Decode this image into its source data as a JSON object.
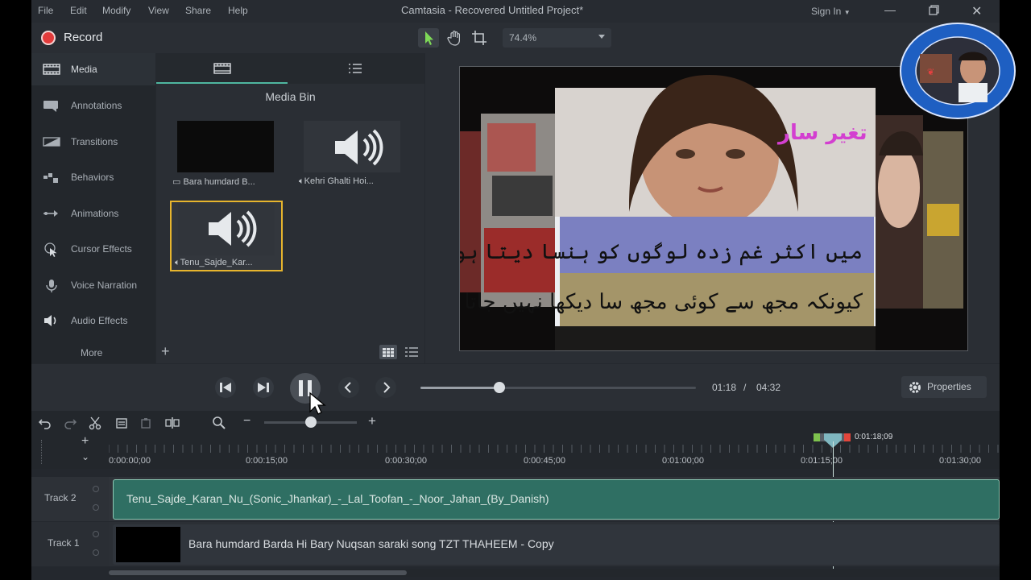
{
  "menu": {
    "items": [
      "File",
      "Edit",
      "Modify",
      "View",
      "Share",
      "Help"
    ],
    "title": "Camtasia - Recovered  Untitled Project*",
    "sign_in": "Sign In"
  },
  "toolbar": {
    "record_label": "Record",
    "zoom": "74.4%"
  },
  "leftnav": {
    "items": [
      {
        "label": "Media",
        "icon": "film-strip-icon"
      },
      {
        "label": "Annotations",
        "icon": "callout-icon"
      },
      {
        "label": "Transitions",
        "icon": "transition-icon"
      },
      {
        "label": "Behaviors",
        "icon": "behaviors-icon"
      },
      {
        "label": "Animations",
        "icon": "arrow-animation-icon"
      },
      {
        "label": "Cursor Effects",
        "icon": "cursor-effects-icon"
      },
      {
        "label": "Voice Narration",
        "icon": "microphone-icon"
      },
      {
        "label": "Audio Effects",
        "icon": "speaker-icon"
      }
    ],
    "more": "More"
  },
  "media_bin": {
    "title": "Media Bin",
    "items": [
      {
        "label": "Bara humdard B...",
        "kind": "video"
      },
      {
        "label": "Kehri Ghalti Hoi...",
        "kind": "audio"
      },
      {
        "label": "Tenu_Sajde_Kar...",
        "kind": "audio"
      }
    ]
  },
  "playback": {
    "current": "01:18",
    "separator": "/",
    "total": "04:32",
    "progress": 0.287,
    "properties_label": "Properties"
  },
  "timeline": {
    "zoom_level": 0.5,
    "ruler": [
      "0:00:00;00",
      "0:00:15;00",
      "0:00:30;00",
      "0:00:45;00",
      "0:01:00;00",
      "0:01:15;00",
      "0:01:30;00"
    ],
    "playhead_time": "0:01:18;09",
    "tracks": [
      {
        "name": "Track 2",
        "clip": "Tenu_Sajde_Karan_Nu_(Sonic_Jhankar)_-_Lal_Toofan_-_Noor_Jahan_(By_Danish)"
      },
      {
        "name": "Track 1",
        "clip": "Bara humdard Barda Hi Bary Nuqsan saraki song TZT THAHEEM - Copy"
      }
    ]
  },
  "colors": {
    "accent": "#4fb6a0",
    "record": "#e23b3b",
    "selected_border": "#e7b52d",
    "clip_audio": "#2f6f63"
  }
}
